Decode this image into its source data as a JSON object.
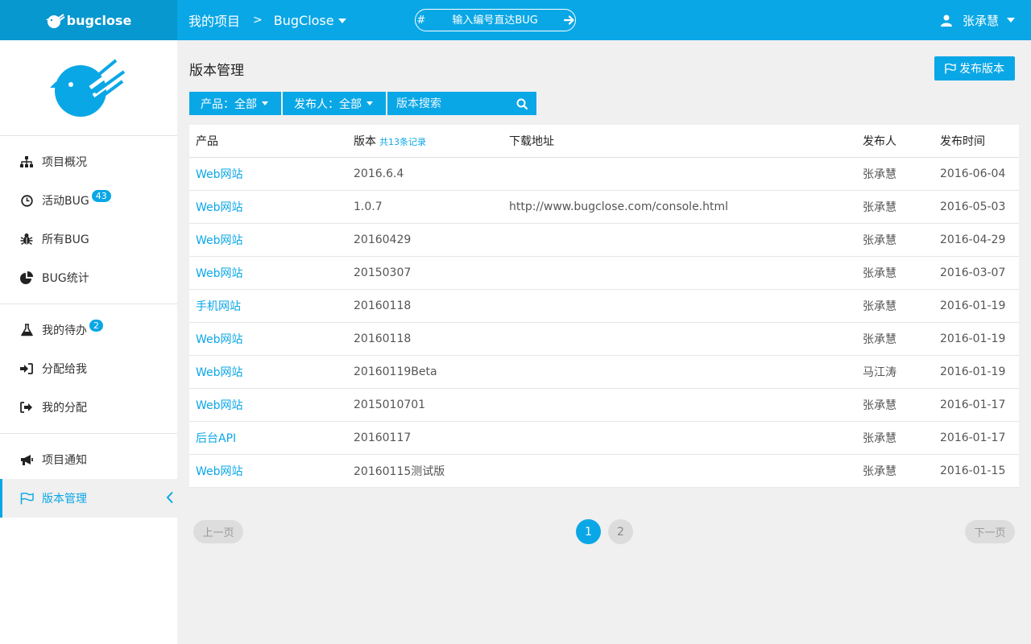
{
  "header": {
    "logo_text": "bugclose",
    "breadcrumb_root": "我的项目",
    "breadcrumb_separator": ">",
    "project_name": "BugClose",
    "bug_jump_placeholder": "输入编号直达BUG",
    "bug_jump_prefix": "#",
    "user_name": "张承慧"
  },
  "sidebar": {
    "groups": [
      [
        {
          "label": "项目概况",
          "icon": "sitemap-icon"
        },
        {
          "label": "活动BUG",
          "icon": "clock-icon",
          "badge": "43"
        },
        {
          "label": "所有BUG",
          "icon": "bug-icon"
        },
        {
          "label": "BUG统计",
          "icon": "pie-chart-icon"
        }
      ],
      [
        {
          "label": "我的待办",
          "icon": "flask-icon",
          "badge": "2"
        },
        {
          "label": "分配给我",
          "icon": "sign-in-icon"
        },
        {
          "label": "我的分配",
          "icon": "sign-out-icon"
        }
      ],
      [
        {
          "label": "项目通知",
          "icon": "bullhorn-icon"
        },
        {
          "label": "版本管理",
          "icon": "flag-icon",
          "active": true
        }
      ]
    ]
  },
  "main": {
    "title": "版本管理",
    "publish_button": "发布版本",
    "filters": {
      "product": "产品：全部",
      "publisher": "发布人：全部",
      "search_placeholder": "版本搜索"
    },
    "table": {
      "headers": {
        "product": "产品",
        "version": "版本",
        "record_count": "共13条记录",
        "download": "下载地址",
        "publisher": "发布人",
        "date": "发布时间"
      },
      "rows": [
        {
          "product": "Web网站",
          "version": "2016.6.4",
          "download": "",
          "publisher": "张承慧",
          "date": "2016-06-04"
        },
        {
          "product": "Web网站",
          "version": "1.0.7",
          "download": "http://www.bugclose.com/console.html",
          "publisher": "张承慧",
          "date": "2016-05-03"
        },
        {
          "product": "Web网站",
          "version": "20160429",
          "download": "",
          "publisher": "张承慧",
          "date": "2016-04-29"
        },
        {
          "product": "Web网站",
          "version": "20150307",
          "download": "",
          "publisher": "张承慧",
          "date": "2016-03-07"
        },
        {
          "product": "手机网站",
          "version": "20160118",
          "download": "",
          "publisher": "张承慧",
          "date": "2016-01-19"
        },
        {
          "product": "Web网站",
          "version": "20160118",
          "download": "",
          "publisher": "张承慧",
          "date": "2016-01-19"
        },
        {
          "product": "Web网站",
          "version": "20160119Beta",
          "download": "",
          "publisher": "马江涛",
          "date": "2016-01-19"
        },
        {
          "product": "Web网站",
          "version": "2015010701",
          "download": "",
          "publisher": "张承慧",
          "date": "2016-01-17"
        },
        {
          "product": "后台API",
          "version": "20160117",
          "download": "",
          "publisher": "张承慧",
          "date": "2016-01-17"
        },
        {
          "product": "Web网站",
          "version": "20160115测试版",
          "download": "",
          "publisher": "张承慧",
          "date": "2016-01-15"
        }
      ]
    },
    "pagination": {
      "prev": "上一页",
      "next": "下一页",
      "pages": [
        "1",
        "2"
      ],
      "current": "1"
    }
  },
  "colors": {
    "accent": "#0aa7e6",
    "accent_dark": "#0698cf"
  }
}
